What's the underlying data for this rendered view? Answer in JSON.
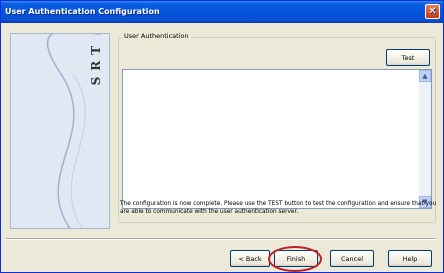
{
  "window": {
    "title": "User Authentication Configuration",
    "close_glyph": "✕"
  },
  "side_panel": {
    "brand_text": "SRT"
  },
  "group": {
    "label": "User Authentication",
    "test_label": "Test"
  },
  "listbox": {
    "up_arrow": "▲",
    "down_arrow": "▼"
  },
  "message": "The configuration is now complete. Please use the TEST button to test the configuration and ensure that you are able to communicate with the user authentication server.",
  "footer": {
    "back_label": "< Back",
    "finish_label": "Finish",
    "cancel_label": "Cancel",
    "help_label": "Help"
  },
  "colors": {
    "title_bar": "#0654dd",
    "highlight": "#c0202a"
  }
}
